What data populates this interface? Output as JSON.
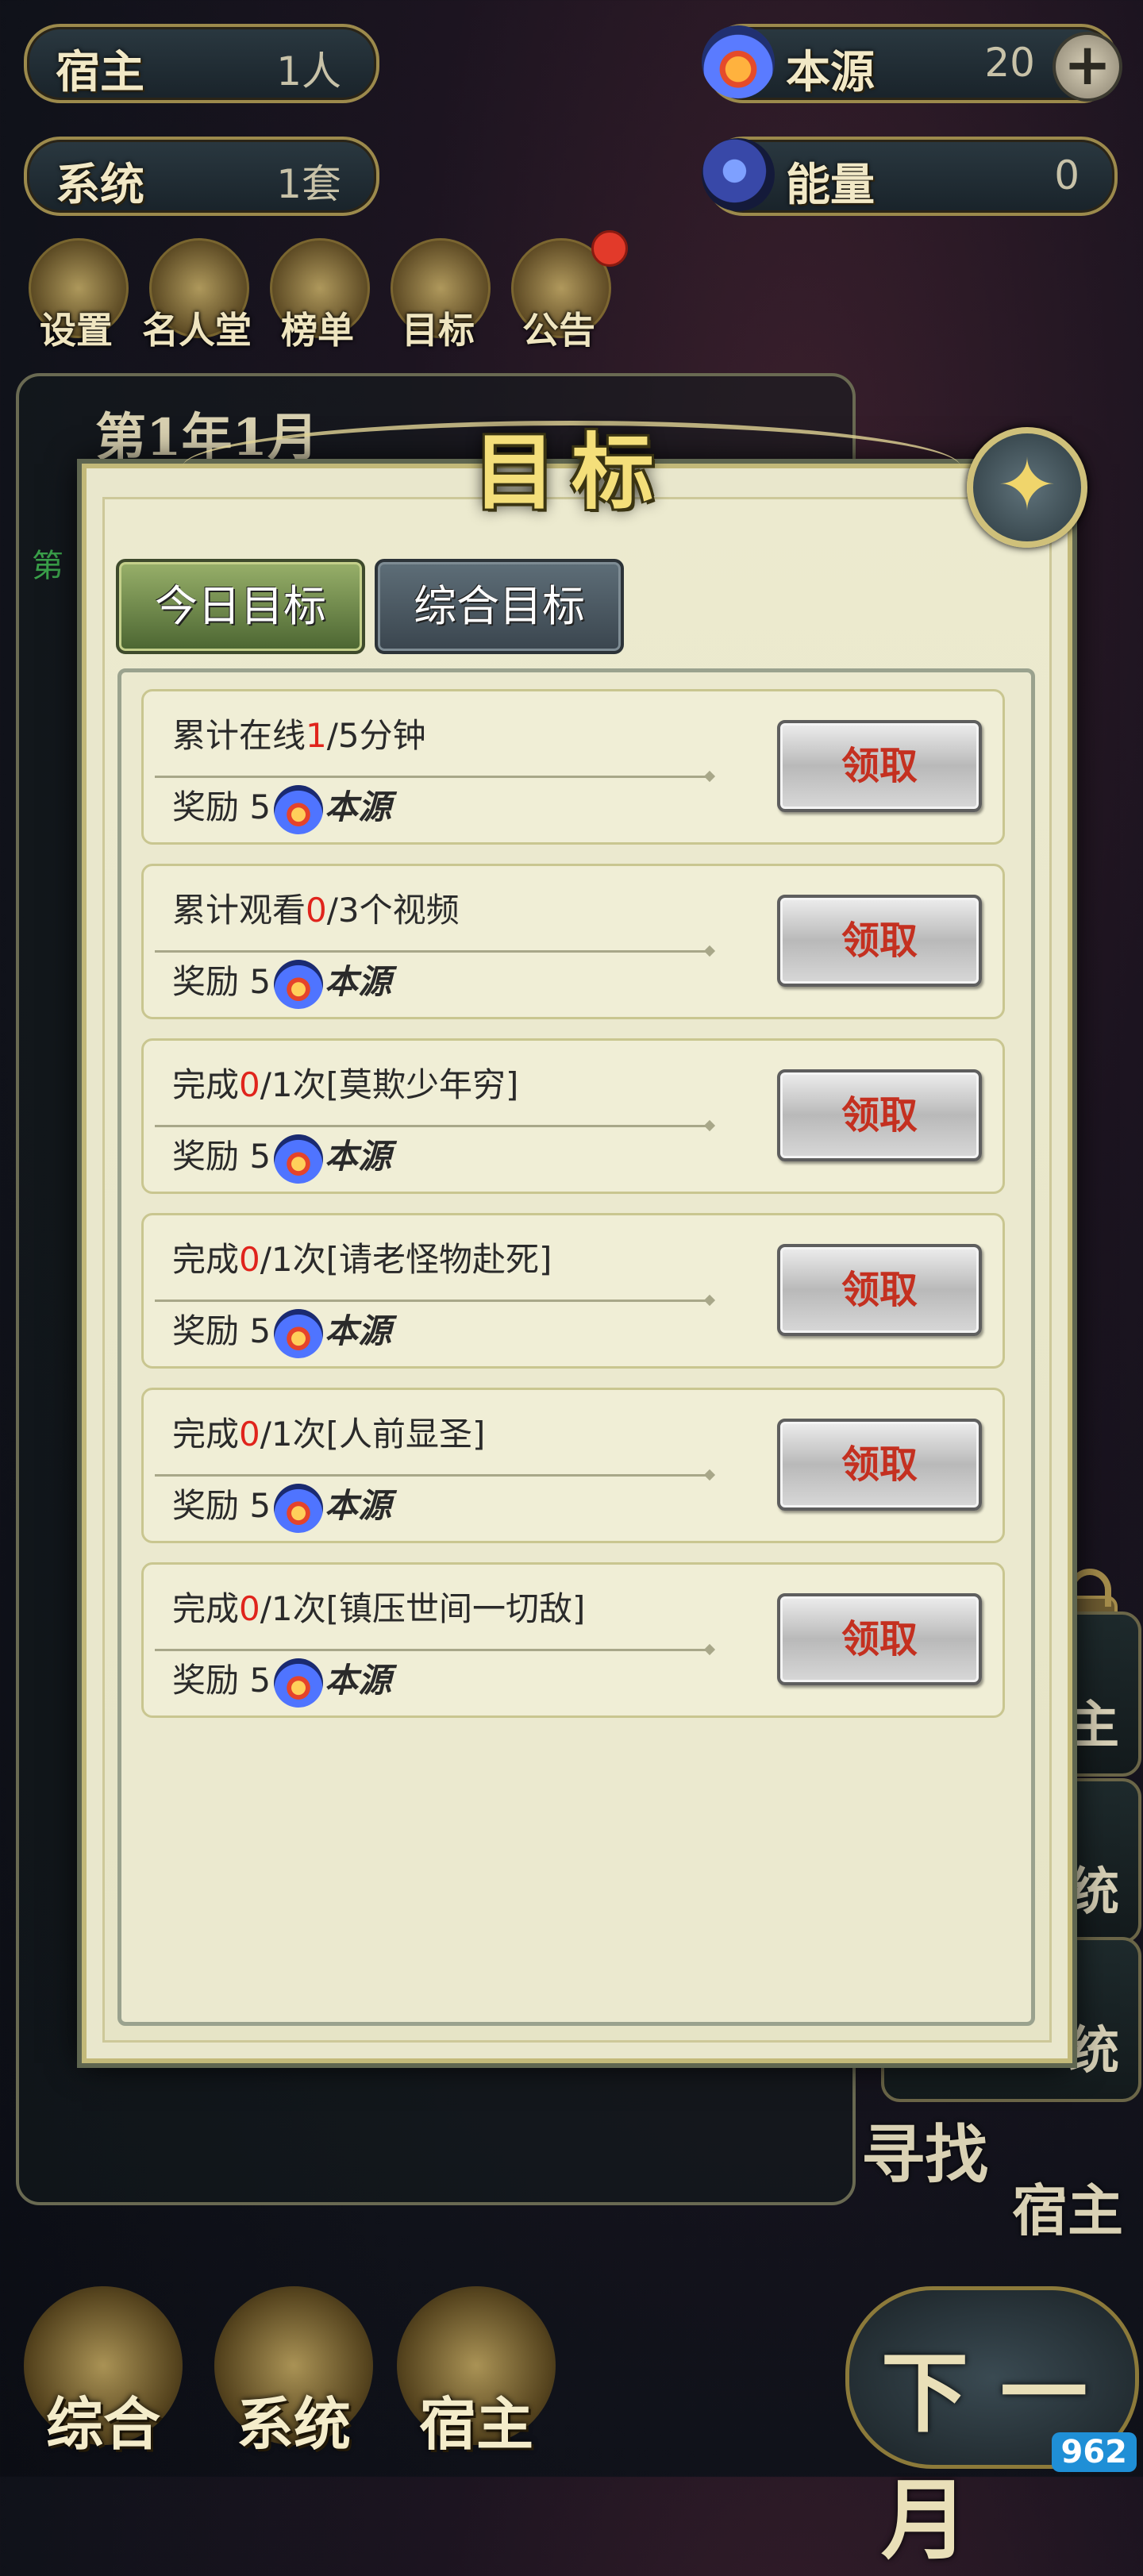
{
  "hud": {
    "host_label": "宿主",
    "host_value": "1人",
    "system_label": "系统",
    "system_value": "1套",
    "source_label": "本源",
    "source_value": "20",
    "source_add": "+",
    "energy_label": "能量",
    "energy_value": "0"
  },
  "menu": [
    "设置",
    "名人堂",
    "榜单",
    "目标",
    "公告"
  ],
  "background": {
    "date": "第1年1月",
    "green_hint": "第",
    "side_buttons": [
      "主",
      "统",
      "统"
    ],
    "find_host": [
      "寻找",
      "宿主"
    ],
    "next_month": "下一月",
    "bottom_nav": [
      "综合",
      "系统",
      "宿主"
    ],
    "watermark": "962"
  },
  "modal": {
    "title": "目标",
    "close_glyph": "✦",
    "tabs": [
      "今日目标",
      "综合目标"
    ],
    "goals": [
      {
        "prefix": "累计在线",
        "progress": "1",
        "suffix": "/5分钟",
        "reward_label": "奖励 5",
        "reward_name": "本源",
        "button": "领取"
      },
      {
        "prefix": "累计观看",
        "progress": "0",
        "suffix": "/3个视频",
        "reward_label": "奖励 5",
        "reward_name": "本源",
        "button": "领取"
      },
      {
        "prefix": "完成",
        "progress": "0",
        "suffix": "/1次[莫欺少年穷]",
        "reward_label": "奖励 5",
        "reward_name": "本源",
        "button": "领取"
      },
      {
        "prefix": "完成",
        "progress": "0",
        "suffix": "/1次[请老怪物赴死]",
        "reward_label": "奖励 5",
        "reward_name": "本源",
        "button": "领取"
      },
      {
        "prefix": "完成",
        "progress": "0",
        "suffix": "/1次[人前显圣]",
        "reward_label": "奖励 5",
        "reward_name": "本源",
        "button": "领取"
      },
      {
        "prefix": "完成",
        "progress": "0",
        "suffix": "/1次[镇压世间一切敌]",
        "reward_label": "奖励 5",
        "reward_name": "本源",
        "button": "领取"
      }
    ]
  }
}
